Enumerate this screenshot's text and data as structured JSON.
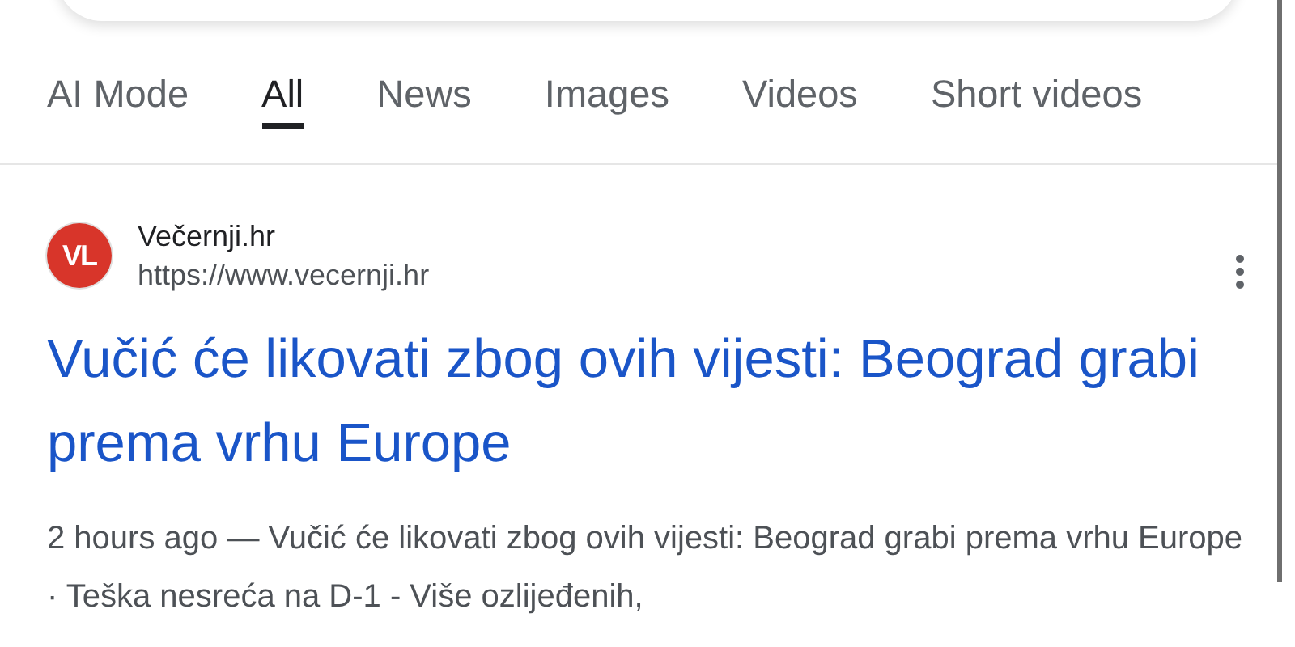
{
  "tabs": [
    {
      "label": "AI Mode",
      "selected": false
    },
    {
      "label": "All",
      "selected": true
    },
    {
      "label": "News",
      "selected": false
    },
    {
      "label": "Images",
      "selected": false
    },
    {
      "label": "Videos",
      "selected": false
    },
    {
      "label": "Short videos",
      "selected": false
    }
  ],
  "result": {
    "site_name": "Večernji.hr",
    "url": "https://www.vecernji.hr",
    "logo_text": "VL",
    "title": "Vučić će likovati zbog ovih vijesti: Beograd grabi prema vrhu Europe",
    "snippet": "2 hours ago — Vučić će likovati zbog ovih vijesti: Beograd grabi prema vrhu Europe · Teška nesreća na D-1 - Više ozlijeđenih,"
  }
}
